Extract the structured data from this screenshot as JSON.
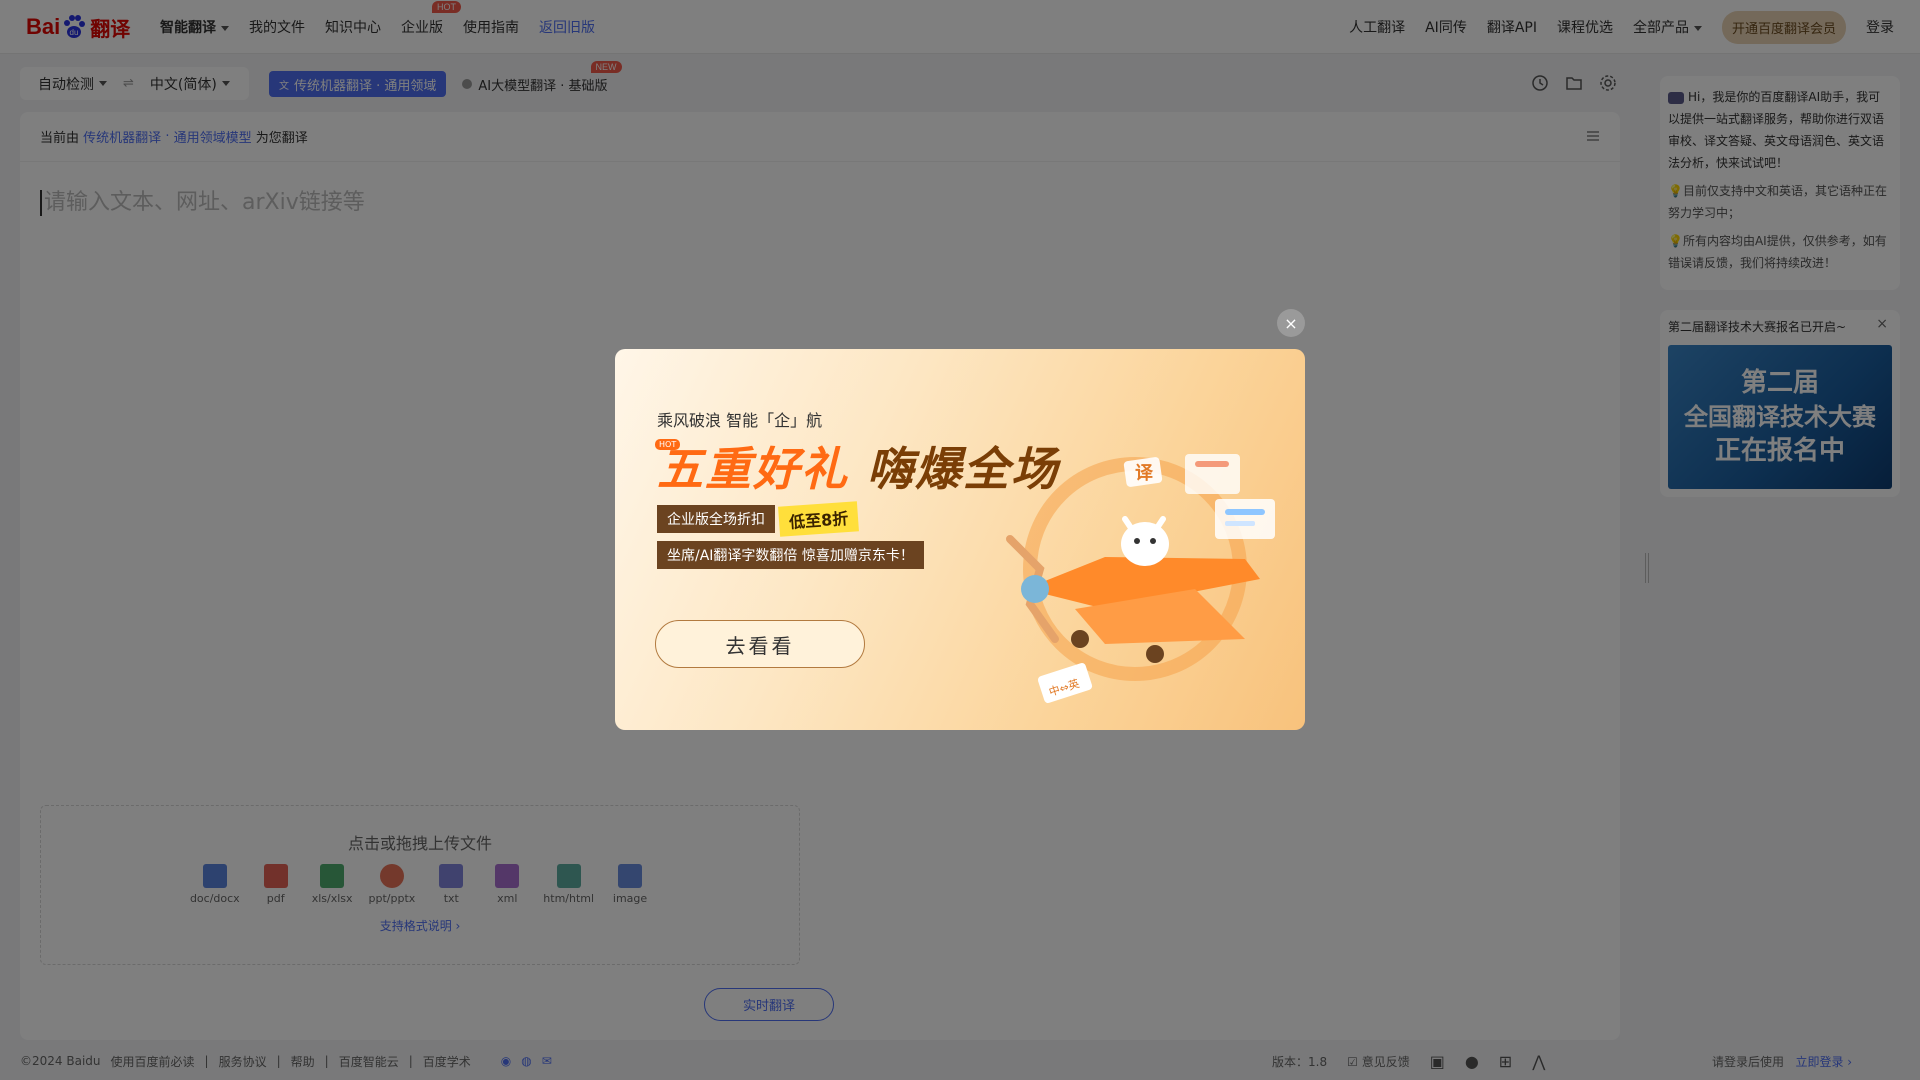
{
  "nav": {
    "logo_text_1": "Bai",
    "logo_text_2": "翻译",
    "left": [
      {
        "label": "智能翻译"
      },
      {
        "label": "我的文件"
      },
      {
        "label": "知识中心"
      },
      {
        "label": "企业版",
        "badge": "HOT"
      },
      {
        "label": "使用指南"
      },
      {
        "label": "返回旧版"
      }
    ],
    "right": [
      {
        "label": "人工翻译"
      },
      {
        "label": "AI同传"
      },
      {
        "label": "翻译API"
      },
      {
        "label": "课程优选"
      },
      {
        "label": "全部产品"
      }
    ],
    "vip": "开通百度翻译会员",
    "login": "登录"
  },
  "lang": {
    "source": "自动检测",
    "swap": "⇌",
    "target": "中文(简体)"
  },
  "modes": {
    "traditional": "传统机器翻译 · 通用领域",
    "ai": "AI大模型翻译 · 基础版",
    "ai_badge": "NEW"
  },
  "panel": {
    "prefix": "当前由",
    "link1": "传统机器翻译",
    "dot": "·",
    "link2": "通用领域模型",
    "suffix": "为您翻译",
    "placeholder": "请输入文本、网址、arXiv链接等"
  },
  "upload": {
    "title": "点击或拖拽上传文件",
    "types": [
      {
        "label": "doc/docx",
        "color": "#3d6fd8"
      },
      {
        "label": "pdf",
        "color": "#e0483a"
      },
      {
        "label": "xls/xlsx",
        "color": "#2f9e55"
      },
      {
        "label": "ppt/pptx",
        "color": "#e45a3c"
      },
      {
        "label": "txt",
        "color": "#6a6fd6"
      },
      {
        "label": "xml",
        "color": "#9a55c8"
      },
      {
        "label": "htm/html",
        "color": "#3f9e90"
      },
      {
        "label": "image",
        "color": "#4f78d9"
      }
    ],
    "format_link": "支持格式说明 ›"
  },
  "realtime": "实时翻译",
  "assistant": {
    "greeting": "Hi，我是你的百度翻译AI助手，我可以提供一站式翻译服务，帮助你进行双语审校、译文答疑、英文母语润色、英文语法分析，快来试试吧！",
    "tip1": "目前仅支持中文和英语，其它语种正在努力学习中；",
    "tip2": "所有内容均由AI提供，仅供参考，如有错误请反馈，我们将持续改进！"
  },
  "contest": {
    "title": "第二届翻译技术大赛报名已开启~",
    "banner_l1": "第二届",
    "banner_l2": "全国翻译技术大赛",
    "banner_l3": "正在报名中"
  },
  "footer": {
    "links": [
      "©2024 Baidu",
      "使用百度前必读",
      "|",
      "服务协议",
      "|",
      "帮助",
      "|",
      "百度智能云",
      "|",
      "百度学术"
    ],
    "version": "版本：1.8",
    "feedback": "意见反馈",
    "login_hint": "请登录后使用",
    "login_link": "立即登录 ›"
  },
  "modal": {
    "line1": "乘风破浪 智能「企」航",
    "hot": "HOT",
    "headline_a": "五重好礼",
    "headline_b": "嗨爆全场",
    "discount_label": "企业版全场折扣",
    "discount_value": "低至8折",
    "line4": "坐席/AI翻译字数翻倍 惊喜加赠京东卡！",
    "cta": "去看看",
    "plane_text": "译",
    "card_text": "中⇔英",
    "close": "×"
  }
}
